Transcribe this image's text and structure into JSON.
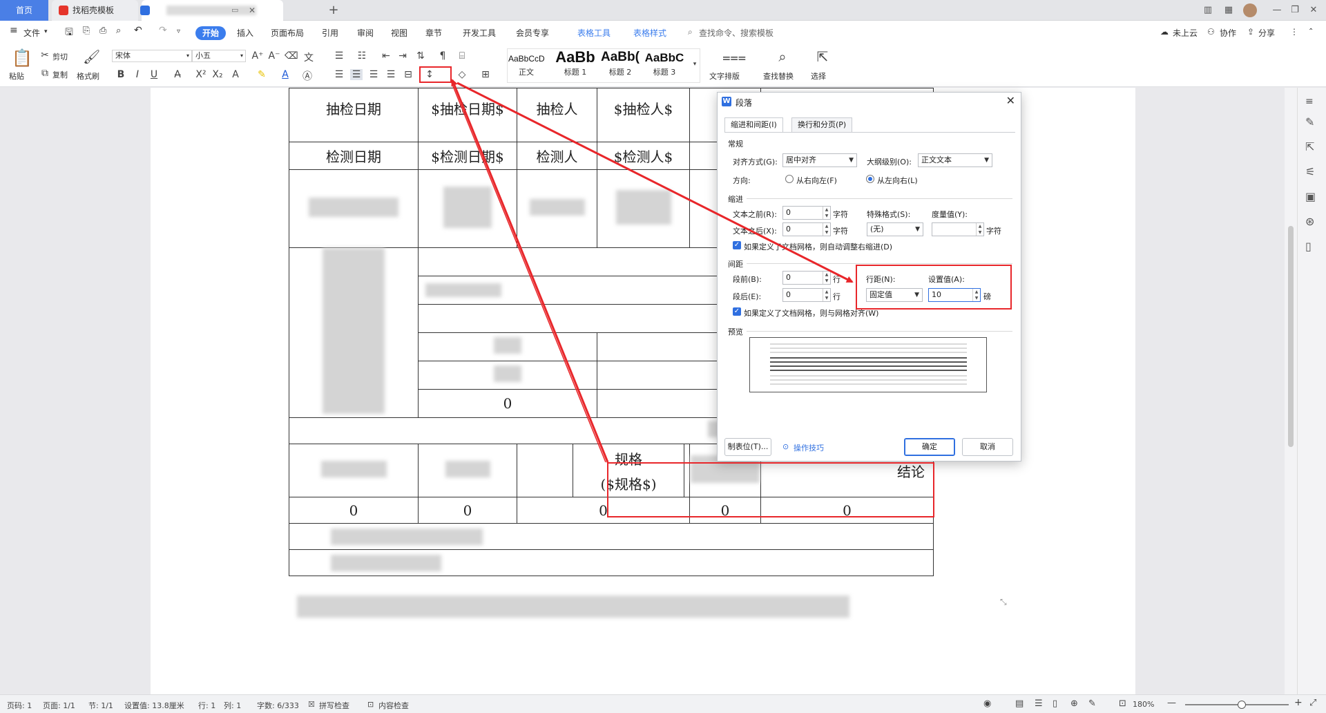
{
  "titlebar": {
    "tabs": [
      {
        "label": "首页",
        "active": false
      },
      {
        "label": "找稻壳模板",
        "active": false
      },
      {
        "label": "",
        "active": true
      }
    ],
    "new_tab": "+"
  },
  "menubar": {
    "file": "文件",
    "start": "开始",
    "items": [
      "插入",
      "页面布局",
      "引用",
      "审阅",
      "视图",
      "章节",
      "开发工具",
      "会员专享"
    ],
    "table_tools": "表格工具",
    "table_style": "表格样式",
    "search_placeholder": "查找命令、搜索模板",
    "cloud": "未上云",
    "collab": "协作",
    "share": "分享"
  },
  "ribbon": {
    "paste": "粘贴",
    "cut": "剪切",
    "copy": "复制",
    "format_painter": "格式刷",
    "font_name": "宋体",
    "font_size": "小五",
    "styles": [
      {
        "preview": "AaBbCcDd",
        "name": "正文"
      },
      {
        "preview": "AaBb",
        "name": "标题 1"
      },
      {
        "preview": "AaBb(",
        "name": "标题 2"
      },
      {
        "preview": "AaBbC",
        "name": "标题 3"
      }
    ],
    "text_layout": "文字排版",
    "find_replace": "查找替换",
    "select": "选择"
  },
  "table": {
    "row1": [
      "抽检日期",
      "$抽检日期$",
      "抽检人",
      "$抽检人$"
    ],
    "row2": [
      "检测日期",
      "$检测日期$",
      "检测人",
      "$检测人$"
    ],
    "mid_zero_1": "0",
    "mid_zero_2": "0",
    "spec_line1": "规格",
    "spec_line2": "($规格$)",
    "conclusion": "结论",
    "zeros": [
      "0",
      "0",
      "0",
      "0",
      "0"
    ]
  },
  "dialog": {
    "title": "段落",
    "tabs": [
      "缩进和间距(I)",
      "换行和分页(P)"
    ],
    "general": "常规",
    "align_label": "对齐方式(G):",
    "align_value": "居中对齐",
    "outline_label": "大纲级别(O):",
    "outline_value": "正文文本",
    "direction_label": "方向:",
    "rtl": "从右向左(F)",
    "ltr": "从左向右(L)",
    "indent": "缩进",
    "before_text_label": "文本之前(R):",
    "before_text_value": "0",
    "after_text_label": "文本之后(X):",
    "after_text_value": "0",
    "unit_char": "字符",
    "special_label": "特殊格式(S):",
    "special_value": "(无)",
    "measure_label": "度量值(Y):",
    "measure_value": "",
    "auto_indent": "如果定义了文档网格，则自动调整右缩进(D)",
    "spacing": "间距",
    "before_label": "段前(B):",
    "before_value": "0",
    "after_label": "段后(E):",
    "after_value": "0",
    "unit_line": "行",
    "line_spacing_label": "行距(N):",
    "line_spacing_value": "固定值",
    "set_value_label": "设置值(A):",
    "set_value": "10",
    "unit_pt": "磅",
    "snap_grid": "如果定义了文档网格，则与网格对齐(W)",
    "preview": "预览",
    "tabs_button": "制表位(T)...",
    "tips": "操作技巧",
    "ok": "确定",
    "cancel": "取消"
  },
  "statusbar": {
    "page_num": "页码: 1",
    "pages": "页面: 1/1",
    "section": "节: 1/1",
    "setting": "设置值: 13.8厘米",
    "row": "行: 1",
    "col": "列: 1",
    "word_count": "字数: 6/333",
    "spell": "拼写检查",
    "content": "内容检查",
    "zoom": "180%"
  },
  "colors": {
    "accent": "#3b7ded",
    "annotation": "#e8262a"
  }
}
